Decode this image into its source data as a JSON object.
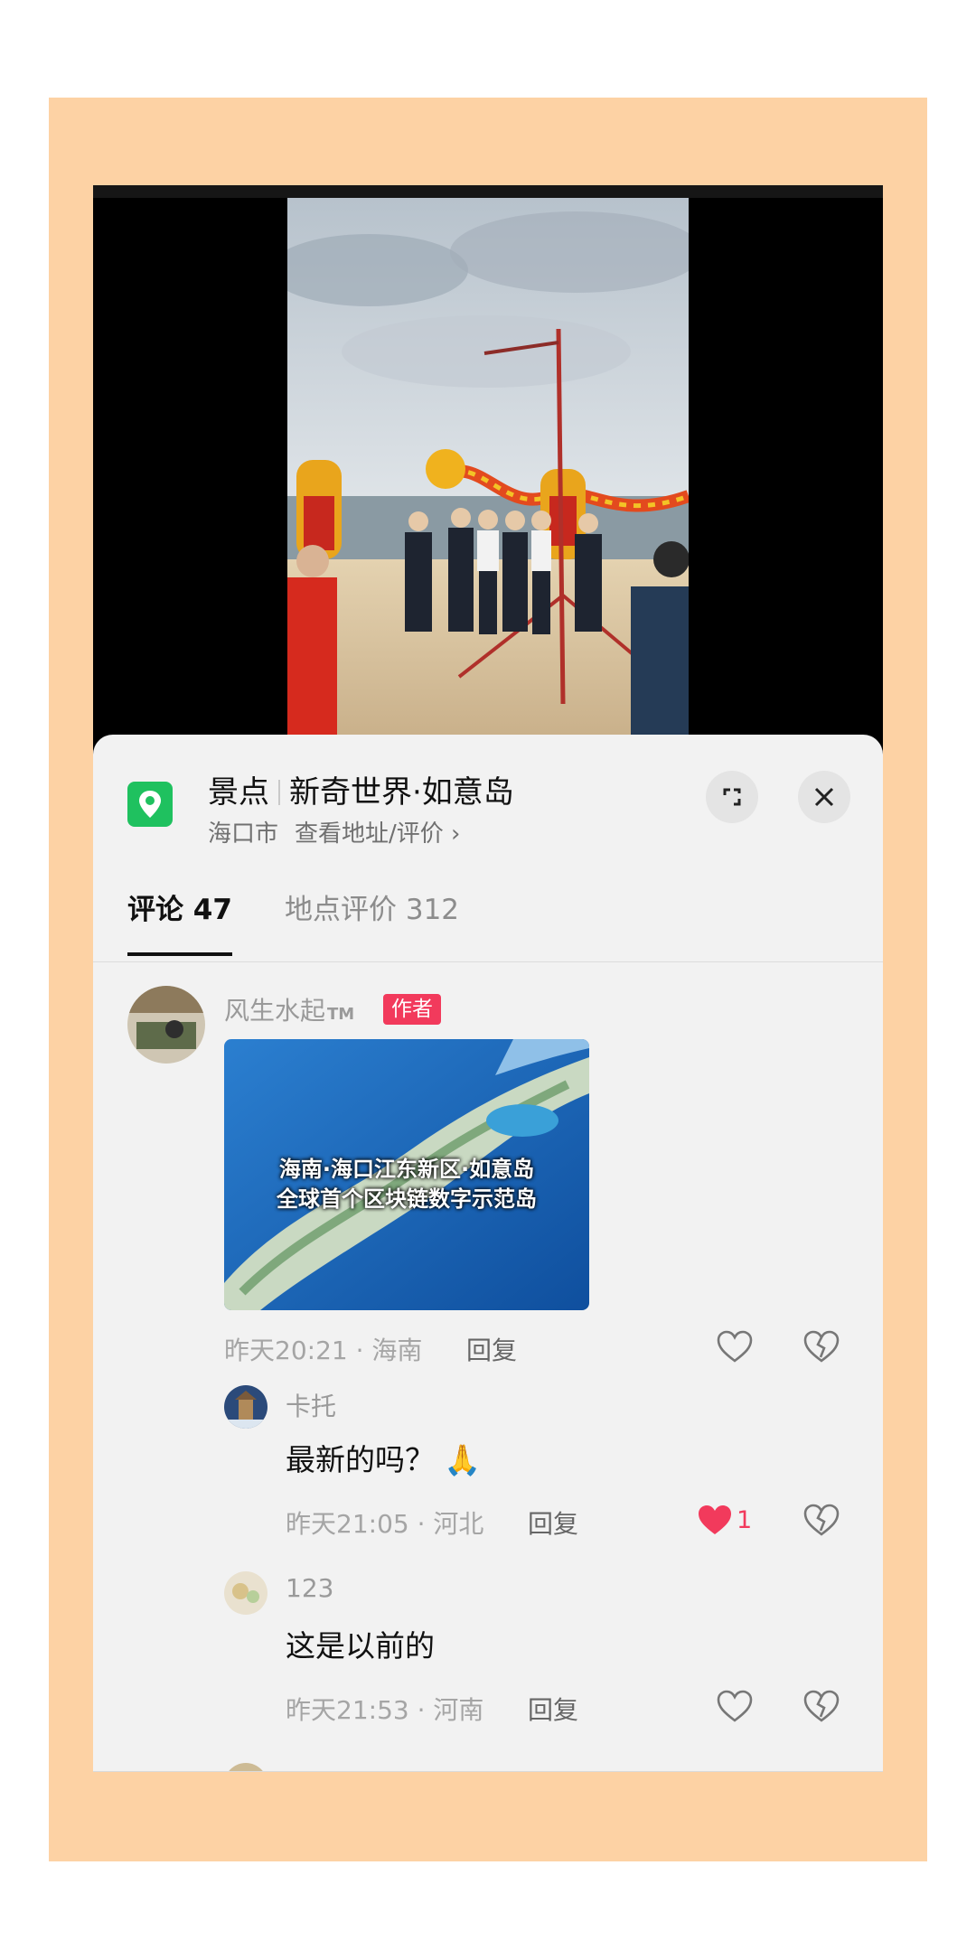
{
  "location": {
    "category": "景点",
    "name": "新奇世界·如意岛",
    "city": "海口市",
    "link": "查看地址/评价 ›"
  },
  "tabs": [
    {
      "label": "评论 47",
      "active": true
    },
    {
      "label": "地点评价 312",
      "active": false
    }
  ],
  "comments": [
    {
      "user": "风生水起",
      "tm": "TM",
      "badge": "作者",
      "image_caption_1": "海南·海口江东新区·如意岛",
      "image_caption_2": "全球首个区块链数字示范岛",
      "meta": "昨天20:21 · 海南",
      "reply": "回复",
      "liked": false
    }
  ],
  "replies": [
    {
      "user": "卡托",
      "text": "最新的吗？",
      "emoji": "🙏",
      "meta": "昨天21:05 · 河北",
      "reply": "回复",
      "liked": true,
      "like_count": "1"
    },
    {
      "user": "123",
      "text": "这是以前的",
      "meta": "昨天21:53 · 河南",
      "reply": "回复",
      "liked": false
    }
  ],
  "colors": {
    "frame": "#fdd2a4",
    "sheet": "#f2f2f2",
    "accent_red": "#f23a5c",
    "location_green": "#1fc15f"
  },
  "icons": {
    "location": "map-pin-icon",
    "expand": "expand-icon",
    "close": "close-icon",
    "like": "heart-icon",
    "dislike": "broken-heart-icon"
  }
}
